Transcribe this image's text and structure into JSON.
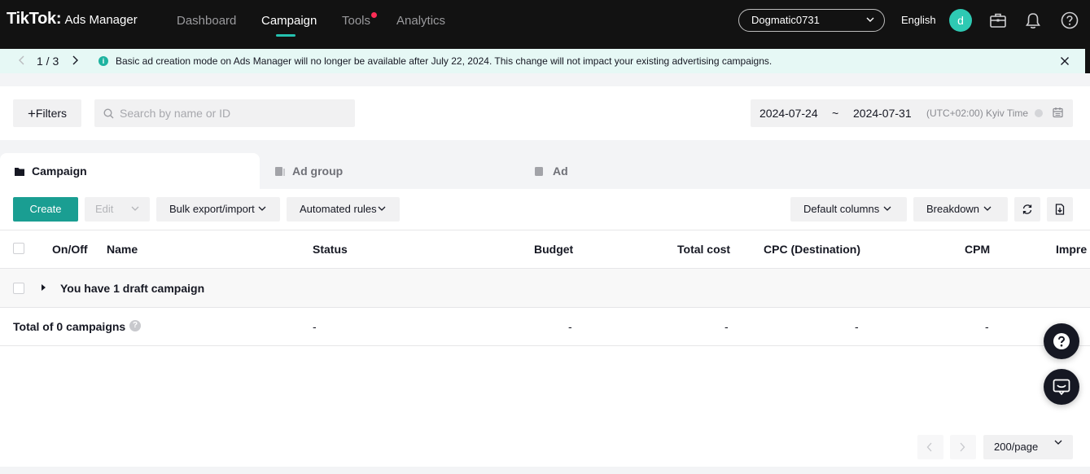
{
  "brand": {
    "name": "TikTok",
    "product": "Ads Manager"
  },
  "nav": {
    "items": [
      {
        "label": "Dashboard",
        "active": false
      },
      {
        "label": "Campaign",
        "active": true
      },
      {
        "label": "Tools",
        "active": false,
        "badge": "red-dot"
      },
      {
        "label": "Analytics",
        "active": false
      }
    ]
  },
  "header": {
    "account": "Dogmatic0731",
    "language": "English",
    "avatar_initial": "d",
    "avatar_color": "#2ec9b3",
    "icons": [
      "briefcase-icon",
      "bell-icon",
      "help-icon"
    ]
  },
  "notice": {
    "page": "1 / 3",
    "text": "Basic ad creation mode on Ads Manager will no longer be available after July 22, 2024. This change will not impact your existing advertising campaigns."
  },
  "filters": {
    "filters_label": "Filters",
    "search_placeholder": "Search by name or ID",
    "date_start": "2024-07-24",
    "date_separator": "~",
    "date_end": "2024-07-31",
    "timezone": "(UTC+02:00) Kyiv Time"
  },
  "level_tabs": [
    {
      "label": "Campaign",
      "active": true
    },
    {
      "label": "Ad group",
      "active": false
    },
    {
      "label": "Ad",
      "active": false
    }
  ],
  "toolbar": {
    "create": "Create",
    "edit": "Edit",
    "bulk": "Bulk export/import",
    "rules": "Automated rules",
    "columns": "Default columns",
    "breakdown": "Breakdown"
  },
  "table": {
    "columns": [
      "On/Off",
      "Name",
      "Status",
      "Budget",
      "Total cost",
      "CPC (Destination)",
      "CPM",
      "Impre"
    ],
    "draft_row": "You have 1 draft campaign",
    "total_row": {
      "label": "Total of 0 campaigns",
      "status": "-",
      "budget": "-",
      "total_cost": "-",
      "cpc": "-",
      "cpm": "-"
    }
  },
  "pagination": {
    "page_size": "200/page"
  },
  "colors": {
    "accent": "#1a9e92",
    "nav_bg": "#121212",
    "notice_bg": "#e6f8f5",
    "badge": "#fe2c55"
  }
}
